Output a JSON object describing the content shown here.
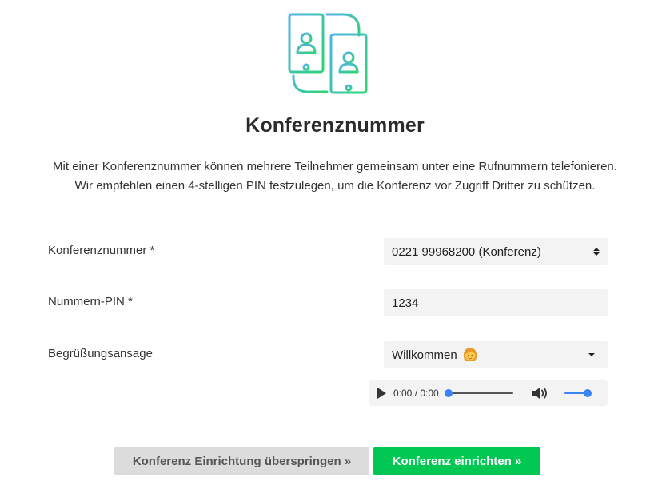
{
  "page": {
    "title": "Konferenznummer",
    "description_line1": "Mit einer Konferenznummer können mehrere Teilnehmer gemeinsam unter eine Rufnummern telefonieren.",
    "description_line2": "Wir empfehlen einen 4-stelligen PIN festzulegen, um die Konferenz vor Zugriff Dritter zu schützen.",
    "hero_icon": "two-phones-contact-icon"
  },
  "form": {
    "conference_number": {
      "label": "Konferenznummer *",
      "selected": "0221 99968200 (Konferenz)"
    },
    "pin": {
      "label": "Nummern-PIN *",
      "value": "1234"
    },
    "greeting": {
      "label": "Begrüßungsansage",
      "selected": "Willkommen",
      "icon": "woman-emoji-icon"
    }
  },
  "audio_player": {
    "time": "0:00 / 0:00",
    "progress": 0,
    "volume": 1
  },
  "actions": {
    "skip_label": "Konferenz Einrichtung überspringen »",
    "setup_label": "Konferenz einrichten »"
  },
  "colors": {
    "accent_green": "#00c853",
    "icon_blue": "#4fb3e8",
    "icon_green": "#2ed573",
    "field_bg": "#f2f3f2",
    "skip_button_bg": "#dcdcdc",
    "player_blue": "#3b82f6"
  }
}
